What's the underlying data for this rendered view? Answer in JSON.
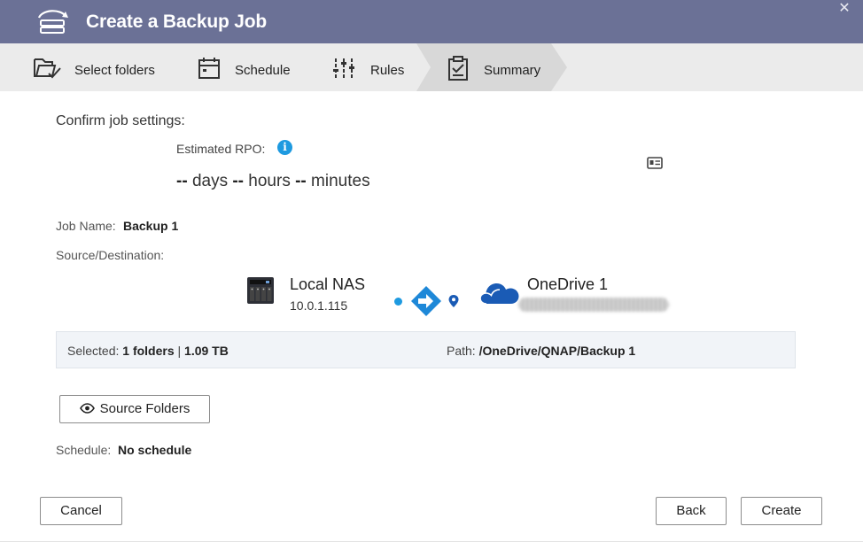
{
  "window": {
    "title": "Create a Backup Job",
    "close_glyph": "✕",
    "title_icon": "backup-drive-icon"
  },
  "steps": [
    {
      "label": "Select folders",
      "icon": "folder-check-icon"
    },
    {
      "label": "Schedule",
      "icon": "calendar-icon"
    },
    {
      "label": "Rules",
      "icon": "sliders-icon"
    },
    {
      "label": "Summary",
      "icon": "clipboard-check-icon",
      "active": true
    }
  ],
  "summary": {
    "confirm_title": "Confirm job settings:",
    "rpo_label": "Estimated RPO:",
    "rpo": {
      "days_value": "--",
      "days_unit": "days",
      "hours_value": "--",
      "hours_unit": "hours",
      "minutes_value": "--",
      "minutes_unit": "minutes"
    },
    "job_name_label": "Job Name:",
    "job_name": "Backup 1",
    "source_dest_label": "Source/Destination:",
    "source": {
      "name": "Local NAS",
      "ip": "10.0.1.115"
    },
    "destination": {
      "name": "OneDrive 1"
    },
    "selected_label": "Selected:",
    "selected_folders": "1 folders",
    "separator": "|",
    "selected_size": "1.09 TB",
    "path_label": "Path:",
    "path": "/OneDrive/QNAP/Backup 1",
    "schedule_label": "Schedule:",
    "schedule": "No schedule"
  },
  "buttons": {
    "source_folders": "Source Folders",
    "cancel": "Cancel",
    "back": "Back",
    "create": "Create"
  },
  "colors": {
    "title_bar": "#6b7196",
    "accent": "#1e9ae0",
    "cloud": "#1a5bb5",
    "step_bar": "#ebebeb",
    "active_step": "#d8d8d8"
  }
}
